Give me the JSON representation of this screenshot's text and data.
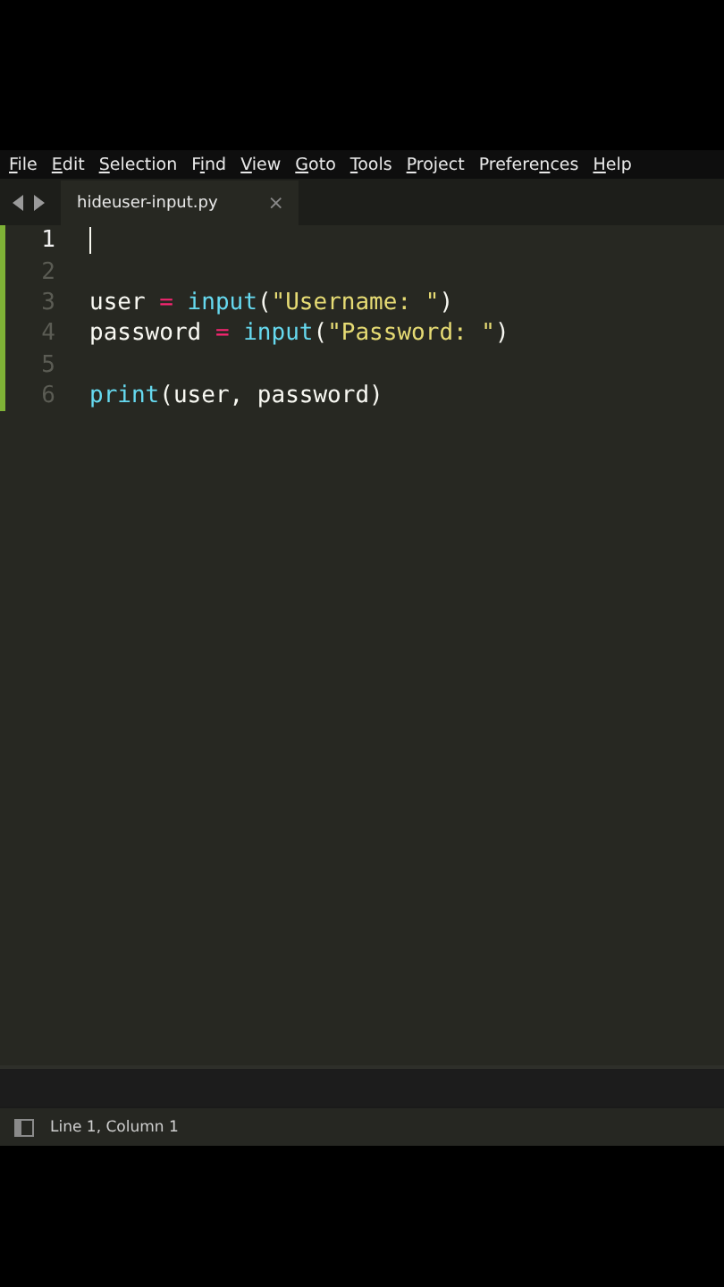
{
  "menu": [
    {
      "key": "F",
      "post": "ile"
    },
    {
      "key": "E",
      "post": "dit"
    },
    {
      "key": "S",
      "post": "election"
    },
    {
      "pre": "F",
      "key": "i",
      "post": "nd"
    },
    {
      "key": "V",
      "post": "iew"
    },
    {
      "key": "G",
      "post": "oto"
    },
    {
      "key": "T",
      "post": "ools"
    },
    {
      "key": "P",
      "post": "roject"
    },
    {
      "pre": "Prefere",
      "key": "n",
      "post": "ces"
    },
    {
      "key": "H",
      "post": "elp"
    }
  ],
  "tabs": [
    {
      "label": "hideuser-input.py",
      "selected": true,
      "close": "×"
    }
  ],
  "editor": {
    "lines": [
      {
        "number": "1",
        "current": true,
        "modified": true
      },
      {
        "number": "2",
        "current": false,
        "modified": true
      },
      {
        "number": "3",
        "current": false,
        "modified": true,
        "tokens": [
          {
            "text": "user ",
            "kind": "plain"
          },
          {
            "text": "=",
            "kind": "operator"
          },
          {
            "text": " input",
            "kind": "builtin"
          },
          {
            "text": "(",
            "kind": "plain"
          },
          {
            "text": "\"Username: \"",
            "kind": "string"
          },
          {
            "text": ")",
            "kind": "plain"
          }
        ]
      },
      {
        "number": "4",
        "current": false,
        "modified": true,
        "tokens": [
          {
            "text": "password ",
            "kind": "plain"
          },
          {
            "text": "=",
            "kind": "operator"
          },
          {
            "text": " input",
            "kind": "builtin"
          },
          {
            "text": "(",
            "kind": "plain"
          },
          {
            "text": "\"Password: \"",
            "kind": "string"
          },
          {
            "text": ")",
            "kind": "plain"
          }
        ]
      },
      {
        "number": "5",
        "current": false,
        "modified": true
      },
      {
        "number": "6",
        "current": false,
        "modified": true,
        "tokens": [
          {
            "text": "print",
            "kind": "builtin"
          },
          {
            "text": "(user, password)",
            "kind": "plain"
          }
        ]
      }
    ]
  },
  "status_bar": {
    "position": "Line 1, Column 1"
  }
}
